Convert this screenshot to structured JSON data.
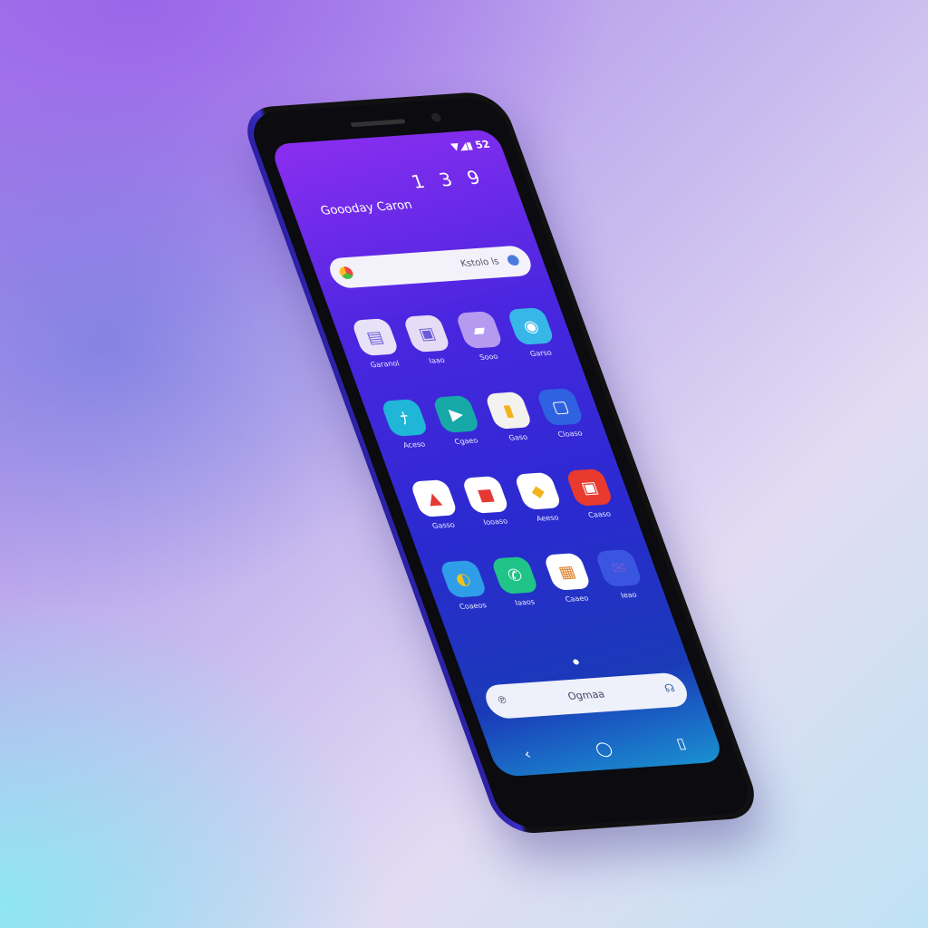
{
  "status_bar": {
    "indicators": "▼◢▮ 52"
  },
  "clock": {
    "hour": "13",
    "minute": "9"
  },
  "greeting": "Goooday Caron",
  "search": {
    "hint": "Kstolo ls",
    "icons": [
      "google-icon",
      "mic-icon"
    ]
  },
  "apps": [
    {
      "label": "Garanol",
      "icon": "notes-icon",
      "bg": "#e8e2f8",
      "glyph": "▤"
    },
    {
      "label": "Iaao",
      "icon": "clipboard-icon",
      "bg": "#e6dcf6",
      "glyph": "▣"
    },
    {
      "label": "Sooo",
      "icon": "folder-icon",
      "bg": "#b59af0",
      "glyph": "▰"
    },
    {
      "label": "Garso",
      "icon": "chat-icon",
      "bg": "#37b7e8",
      "glyph": "◉"
    },
    {
      "label": "Aceso",
      "icon": "translate-icon",
      "bg": "#1fb6d8",
      "glyph": "ﾅ"
    },
    {
      "label": "Cgaeo",
      "icon": "play-store-icon",
      "bg": "#17a8a8",
      "glyph": "▶"
    },
    {
      "label": "Gaso",
      "icon": "files-icon",
      "bg": "#f4f2ee",
      "glyph": "▮"
    },
    {
      "label": "Cloaso",
      "icon": "calendar-icon",
      "bg": "#2f62e0",
      "glyph": "▢"
    },
    {
      "label": "Gasso",
      "icon": "youtube-icon",
      "bg": "#ffffff",
      "glyph": "▲"
    },
    {
      "label": "Iooaso",
      "icon": "slides-icon",
      "bg": "#ffffff",
      "glyph": "■"
    },
    {
      "label": "Aeeso",
      "icon": "drive-icon",
      "bg": "#ffffff",
      "glyph": "◆"
    },
    {
      "label": "Caaso",
      "icon": "photos-icon",
      "bg": "#e83a2e",
      "glyph": "▣"
    },
    {
      "label": "Coaeos",
      "icon": "browser-icon",
      "bg": "#2f9de8",
      "glyph": "◐"
    },
    {
      "label": "Iaaos",
      "icon": "phone-icon",
      "bg": "#20c488",
      "glyph": "✆"
    },
    {
      "label": "Caaeo",
      "icon": "gallery-icon",
      "bg": "#ffffff",
      "glyph": "▦"
    },
    {
      "label": "Ieao",
      "icon": "mail-icon",
      "bg": "#3a56e0",
      "glyph": "✉"
    }
  ],
  "dock_search": {
    "text": "Ogmaa",
    "left": "℗",
    "right": "☊"
  },
  "nav_bar": {
    "back": "‹",
    "home": "◯",
    "recents": "▯"
  }
}
